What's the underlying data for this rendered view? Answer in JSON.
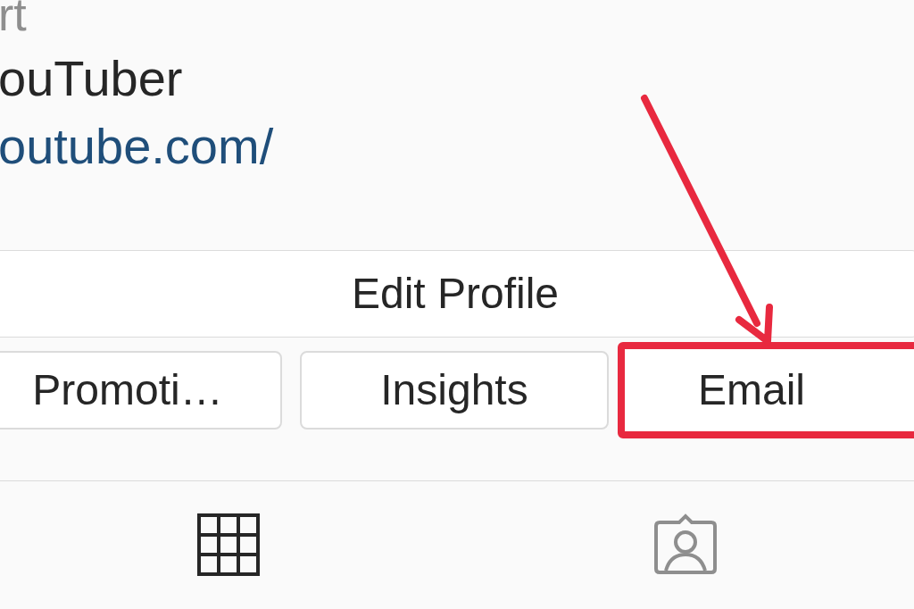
{
  "profile": {
    "name_fragment": "rt",
    "category": "ouTuber",
    "link": "outube.com/"
  },
  "edit_button": {
    "label": "Edit Profile"
  },
  "actions": [
    {
      "label": "Promoti…",
      "highlighted": false
    },
    {
      "label": "Insights",
      "highlighted": false
    },
    {
      "label": "Email",
      "highlighted": true
    }
  ],
  "tabs": [
    {
      "kind": "grid",
      "selected": true
    },
    {
      "kind": "tagged",
      "selected": false
    }
  ]
}
